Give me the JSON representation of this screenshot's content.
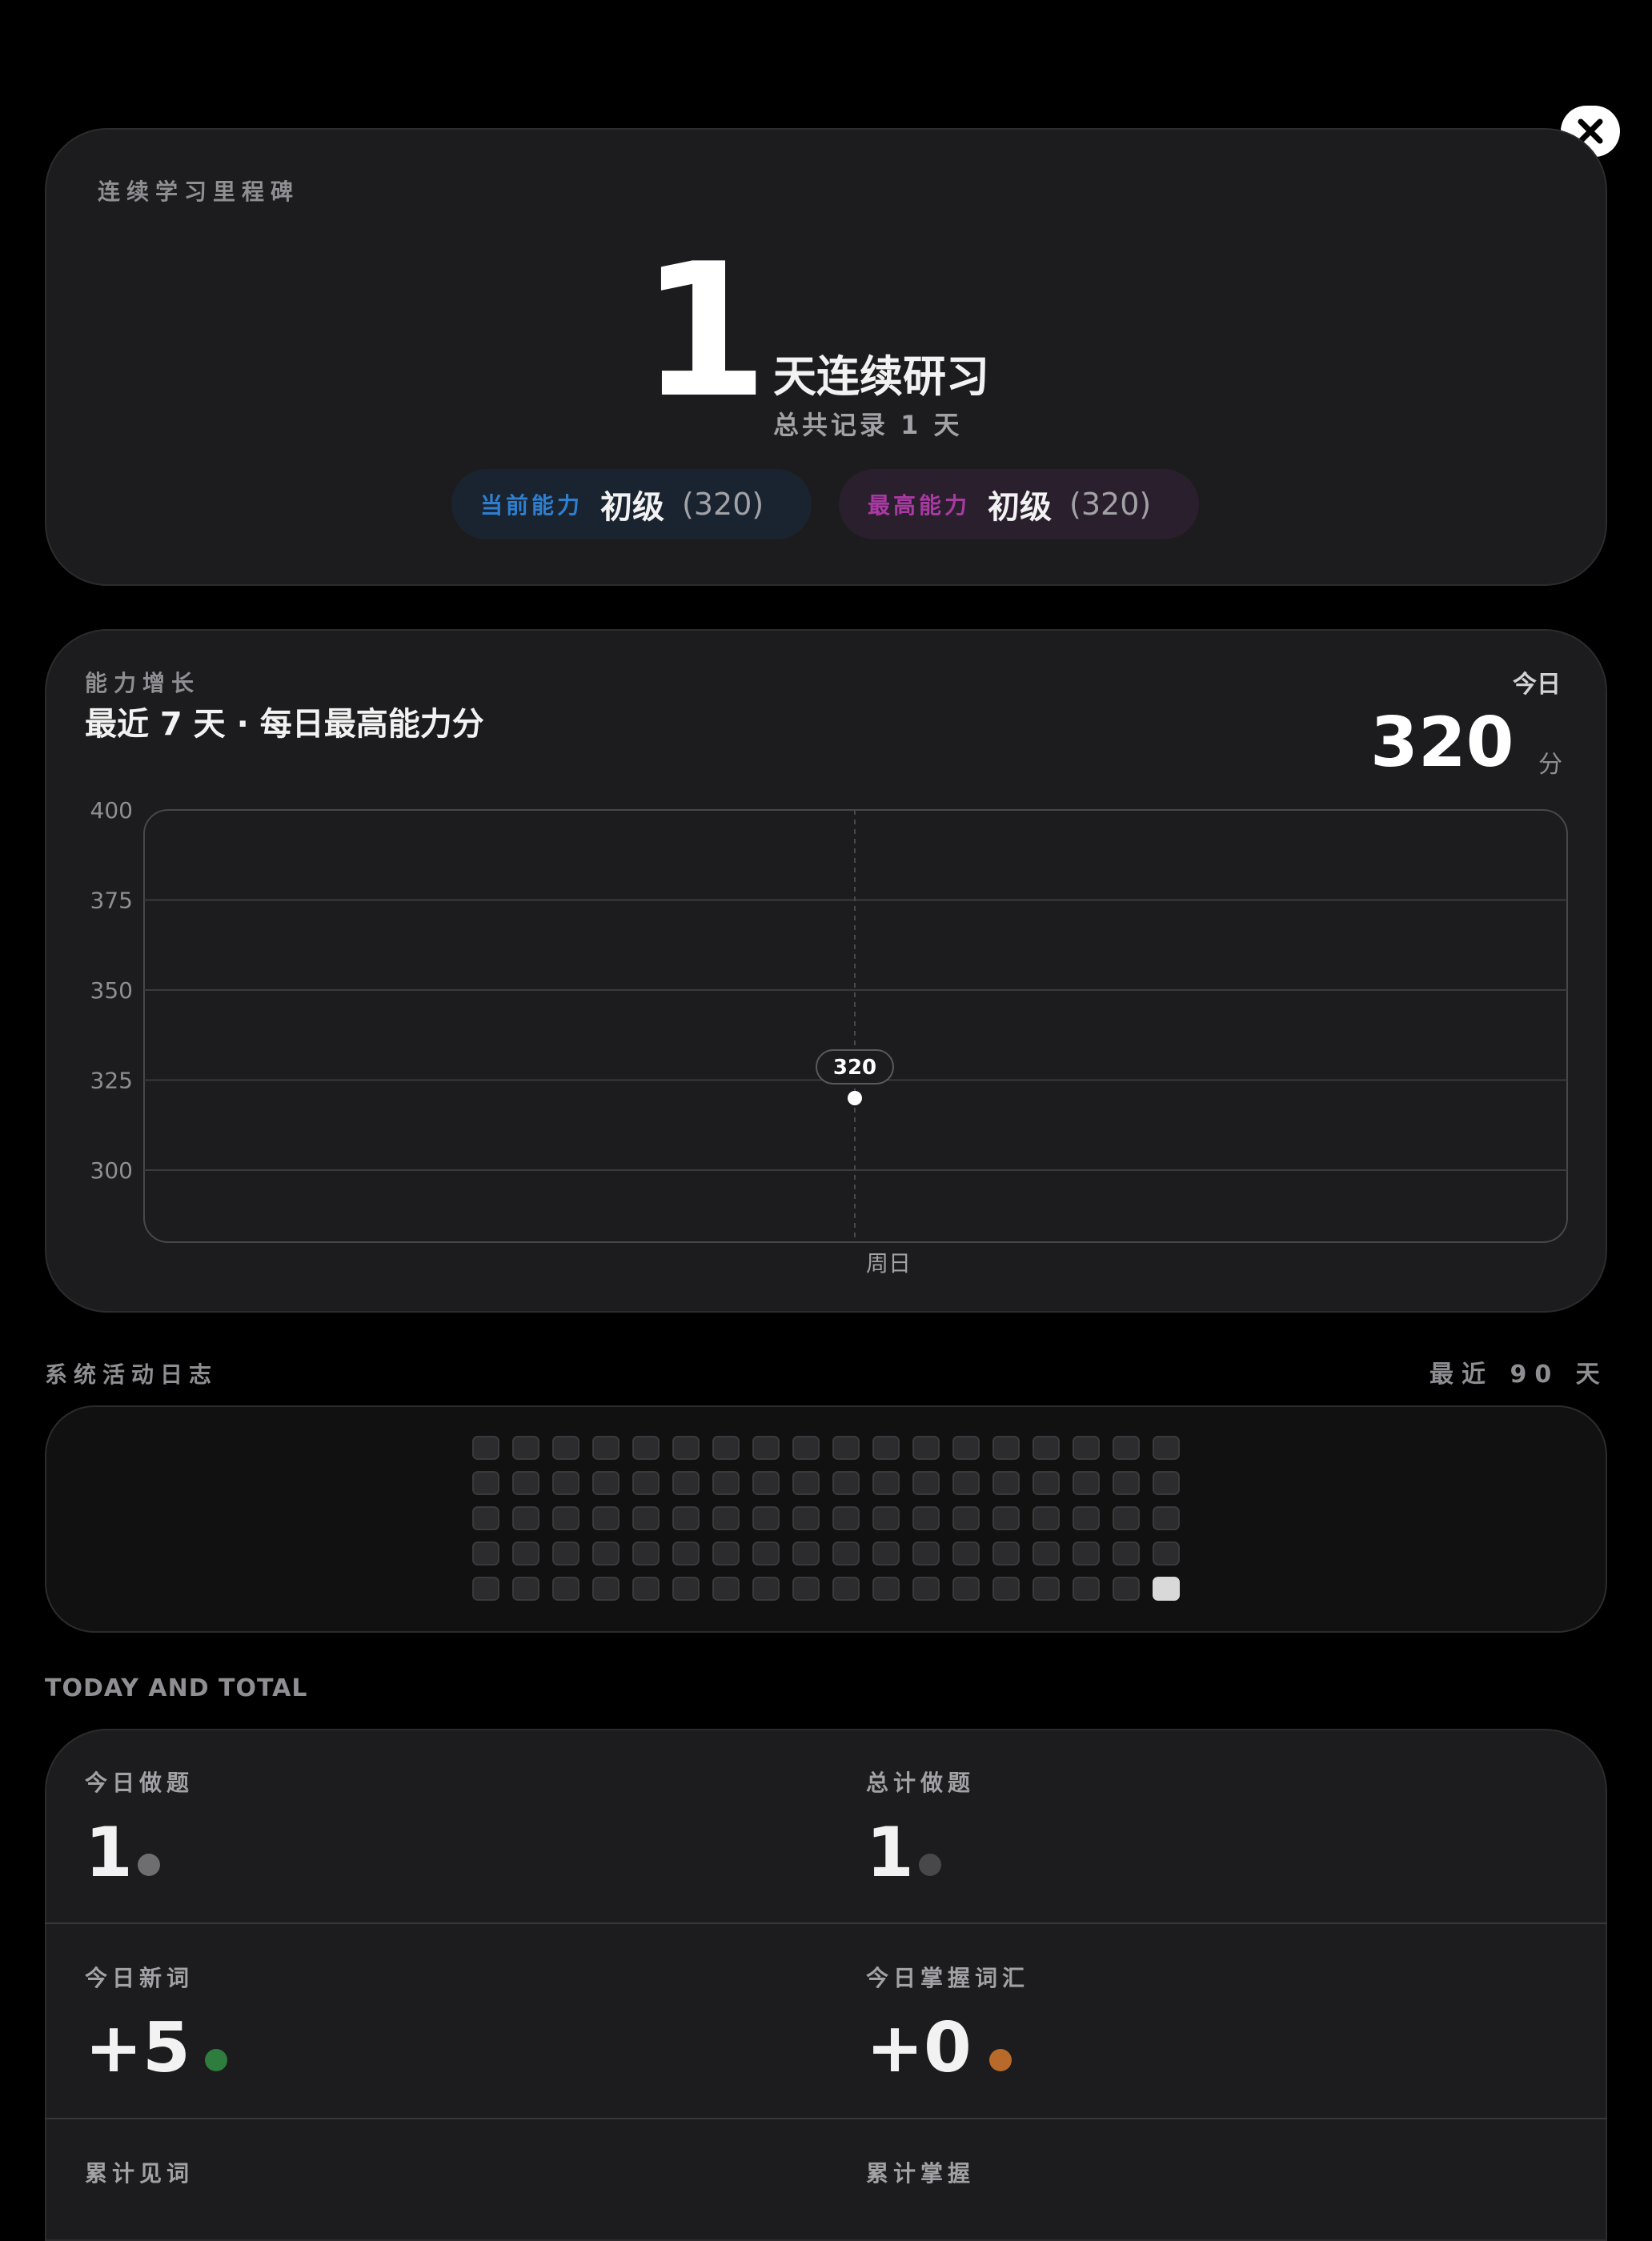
{
  "streak": {
    "section_label": "连续学习里程碑",
    "days": "1",
    "streak_text": "天连续研习",
    "total_text": "总共记录 1 天",
    "current_label": "当前能力",
    "current_level": "初级",
    "current_score": "(320)",
    "max_label": "最高能力",
    "max_level": "初级",
    "max_score": "(320)"
  },
  "growth": {
    "section_label": "能力增长",
    "title": "最近 7 天 · 每日最高能力分",
    "today_label": "今日",
    "today_score": "320",
    "today_unit": "分"
  },
  "chart_data": {
    "type": "line",
    "categories": [
      "周日"
    ],
    "series": [
      {
        "values": [
          320
        ]
      }
    ],
    "y_ticks": [
      "400",
      "375",
      "350",
      "325",
      "300"
    ],
    "ylim": [
      280,
      400
    ],
    "data_labels": [
      "320"
    ],
    "grid": true
  },
  "activity": {
    "section_label": "系统活动日志",
    "range_label": "最近 90 天",
    "rows": 5,
    "cols": 18,
    "active_cells": [
      89
    ],
    "colors": {
      "inactive": "#2c2c2e",
      "active": "#d9d9d9"
    }
  },
  "totals": {
    "heading": "TODAY AND TOTAL",
    "items": [
      {
        "label": "今日做题",
        "value": "1",
        "dot_color": "#6e6e70"
      },
      {
        "label": "总计做题",
        "value": "1",
        "dot_color": "#48484a"
      },
      {
        "label": "今日新词",
        "value": "+5",
        "dot_color": "#2e7d3e"
      },
      {
        "label": "今日掌握词汇",
        "value": "+0",
        "dot_color": "#b86a2a"
      },
      {
        "label": "累计见词",
        "value": ""
      },
      {
        "label": "累计掌握",
        "value": ""
      }
    ]
  },
  "colors": {
    "current_accent": "#2f7fd0",
    "max_accent": "#a93aa3",
    "background": "#000000",
    "card": "#1c1c1e"
  },
  "icons": {
    "close": "close-icon"
  }
}
